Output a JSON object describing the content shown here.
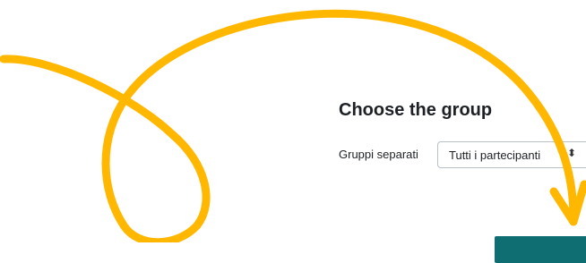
{
  "heading": "Choose the group",
  "group_mode_label": "Gruppi separati",
  "group_select": {
    "selected_value": "Tutti i partecipanti"
  },
  "colors": {
    "arrow": "#ffb700",
    "button": "#0f6e72",
    "text": "#1d2125"
  },
  "icons": {
    "select_caret": "sort-icon",
    "annotation": "curly-arrow-icon"
  }
}
